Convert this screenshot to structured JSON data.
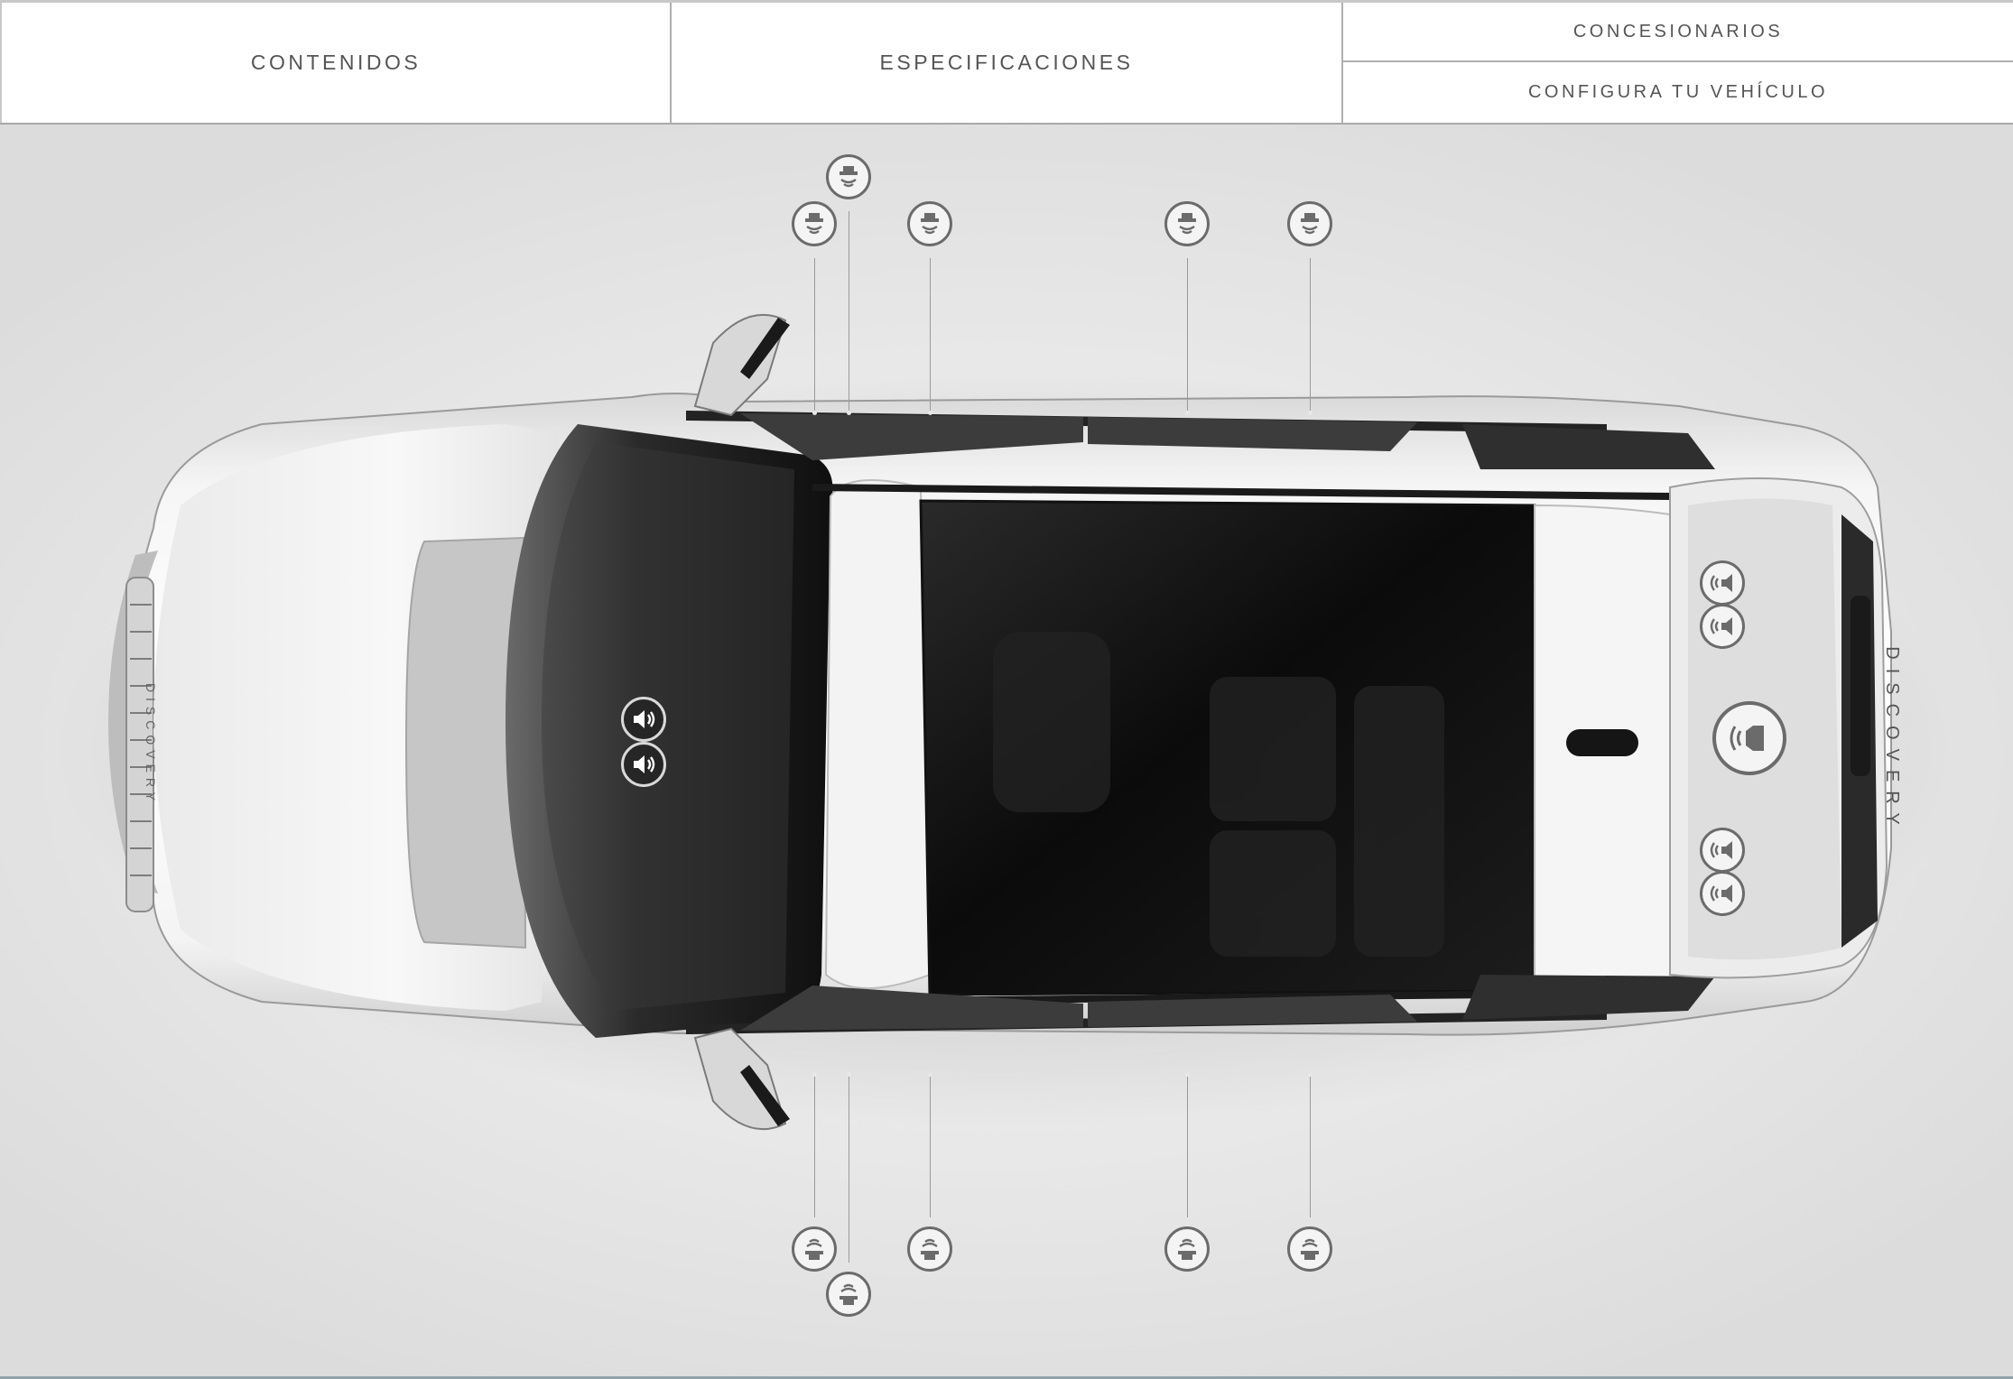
{
  "nav": {
    "contents_label": "CONTENIDOS",
    "specs_label": "ESPECIFICACIONES",
    "dealers_label": "CONCESIONARIOS",
    "configure_label": "CONFIGURA TU VEHÍCULO"
  },
  "car_badge_text": "DISCOVERY",
  "colors": {
    "nav_text": "#555555",
    "marker_stroke": "#6b6b6b",
    "background": "#e6e6e6"
  },
  "speakers": {
    "door_top_icon": "door-speaker-down-icon",
    "door_bottom_icon": "door-speaker-up-icon",
    "dash_icon": "dashboard-speaker-icon",
    "rear_icon": "rear-speaker-icon",
    "subwoofer_icon": "subwoofer-icon"
  }
}
